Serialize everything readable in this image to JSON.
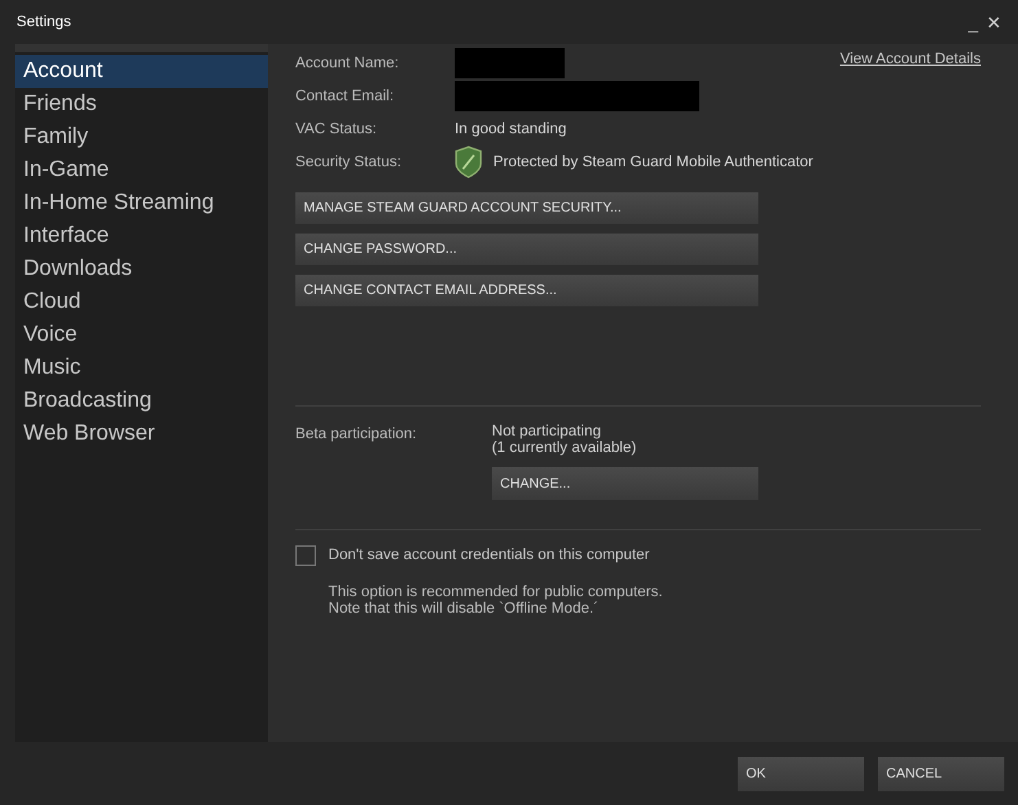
{
  "window": {
    "title": "Settings",
    "controls": [
      "_",
      "✕"
    ]
  },
  "sidebar": {
    "items": [
      {
        "label": "Account",
        "selected": true
      },
      {
        "label": "Friends",
        "selected": false
      },
      {
        "label": "Family",
        "selected": false
      },
      {
        "label": "In-Game",
        "selected": false
      },
      {
        "label": "In-Home Streaming",
        "selected": false
      },
      {
        "label": "Interface",
        "selected": false
      },
      {
        "label": "Downloads",
        "selected": false
      },
      {
        "label": "Cloud",
        "selected": false
      },
      {
        "label": "Voice",
        "selected": false
      },
      {
        "label": "Music",
        "selected": false
      },
      {
        "label": "Broadcasting",
        "selected": false
      },
      {
        "label": "Web Browser",
        "selected": false
      }
    ]
  },
  "account": {
    "link": "View Account Details",
    "fields": [
      {
        "label": "Account Name:",
        "kind": "redacted"
      },
      {
        "label": "Contact Email:",
        "kind": "redacted"
      },
      {
        "label": "VAC Status:",
        "kind": "text",
        "value": "In good standing"
      },
      {
        "label": "Security Status:",
        "kind": "shield",
        "value": "Protected by Steam Guard Mobile Authenticator"
      }
    ],
    "buttons": [
      "MANAGE STEAM GUARD ACCOUNT SECURITY...",
      "CHANGE PASSWORD...",
      "CHANGE CONTACT EMAIL ADDRESS..."
    ]
  },
  "beta": {
    "label": "Beta participation:",
    "status": "Not participating",
    "available": "(1 currently available)",
    "button": "CHANGE..."
  },
  "credentials": {
    "label": "Don't save account credentials on this computer",
    "checked": false,
    "note": [
      "This option is recommended for public computers.",
      "Note that this will disable `Offline Mode.´"
    ]
  },
  "footer": {
    "buttons": [
      "OK",
      "CANCEL"
    ]
  }
}
